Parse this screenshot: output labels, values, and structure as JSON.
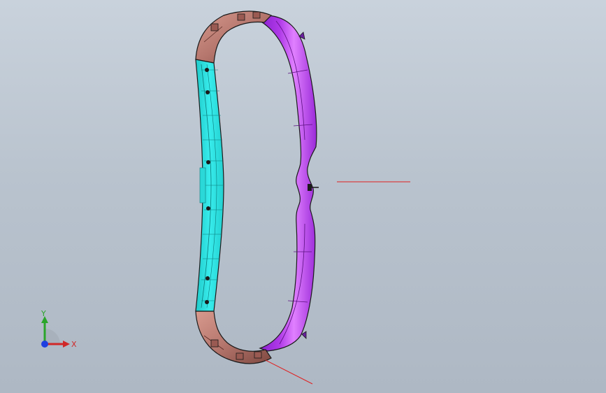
{
  "viewport": {
    "background_top": "#c9d2dc",
    "background_bottom": "#aeb8c4"
  },
  "model": {
    "colors": {
      "left_panel": "#33e6e6",
      "corner_brown": "#b5766d",
      "ring_purple": "#b03ae8",
      "ring_highlight": "#e080ff",
      "edge_dark": "#1a1a1a"
    }
  },
  "annotations": {
    "leader_color": "#e02020"
  },
  "triad": {
    "x_label": "X",
    "y_label": "Y",
    "x_color": "#d02828",
    "y_color": "#2aa52a",
    "origin_color": "#2040e0"
  }
}
